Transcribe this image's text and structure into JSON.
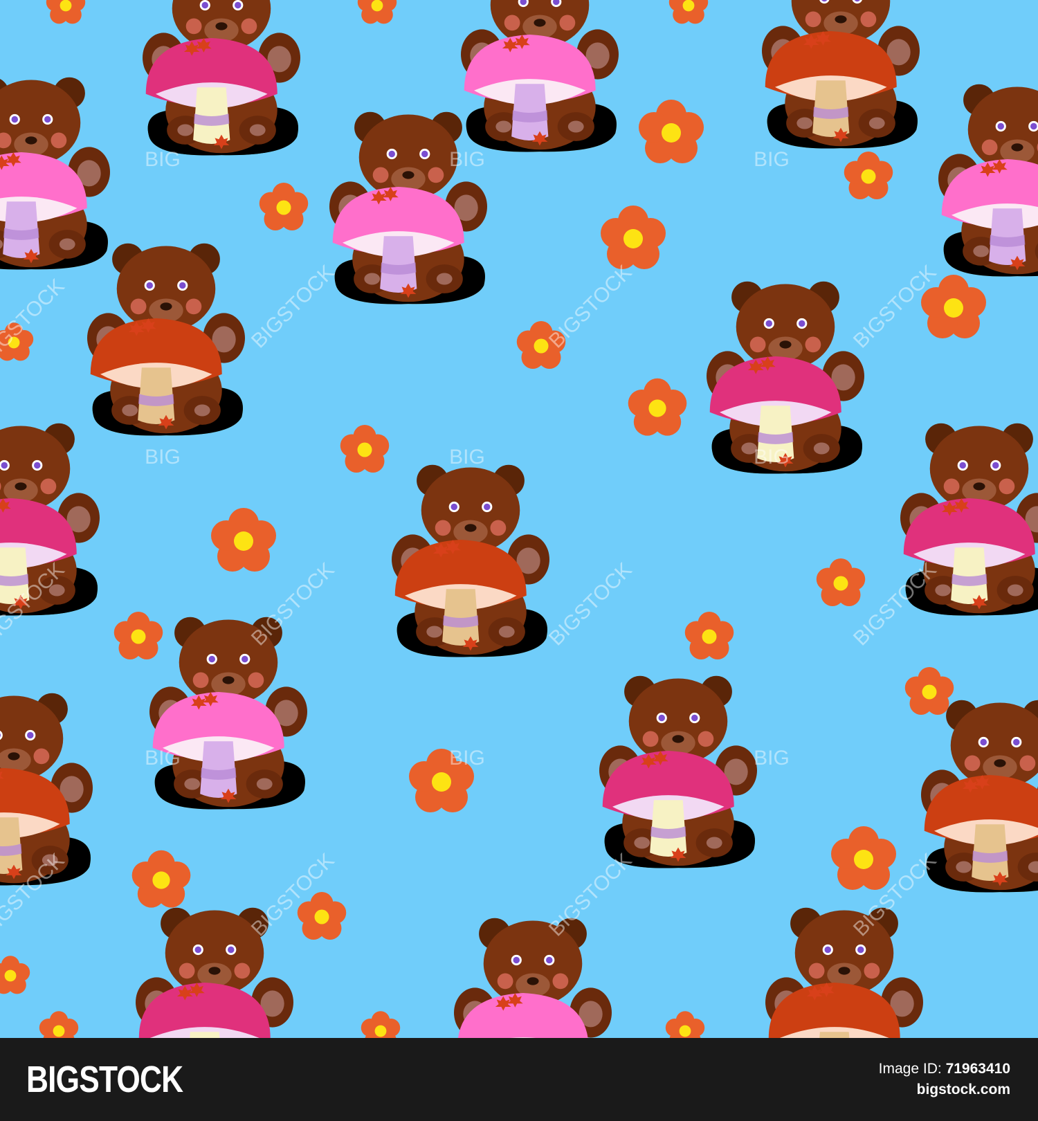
{
  "pattern": {
    "background_color": "#70cdfa",
    "motifs": [
      "brown-bear-icon",
      "mushroom-icon",
      "orange-flower-icon",
      "maple-leaf-icon"
    ]
  },
  "watermark": {
    "text": "BIGSTOCK",
    "short_text": "BIG",
    "color": "#ffffff"
  },
  "footer": {
    "logo": "BIGSTOCK",
    "image_id_label": "Image ID:",
    "image_id_value": "71963410",
    "url": "bigstock.com"
  }
}
